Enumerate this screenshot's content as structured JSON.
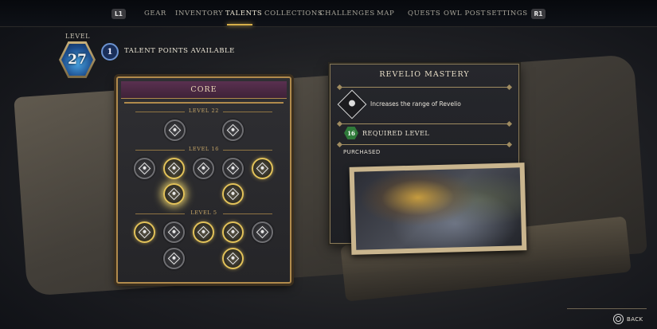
{
  "nav": {
    "left_button": "L1",
    "right_button": "R1",
    "items": [
      "GEAR",
      "INVENTORY",
      "TALENTS",
      "COLLECTIONS",
      "CHALLENGES",
      "MAP",
      "QUESTS",
      "OWL POST",
      "SETTINGS"
    ],
    "active": "TALENTS"
  },
  "player": {
    "level_label": "LEVEL",
    "level": "27",
    "talent_points": "1",
    "talent_points_label": "TALENT POINTS AVAILABLE"
  },
  "core": {
    "title": "CORE",
    "tiers": [
      {
        "label": "LEVEL 22",
        "talents": [
          {
            "icon": "diamond-rune-icon",
            "state": "locked"
          },
          {
            "icon": "diamond-rune-icon",
            "state": "locked"
          }
        ]
      },
      {
        "label": "LEVEL 16",
        "talents": [
          {
            "icon": "diamond-rune-icon",
            "state": "locked"
          },
          {
            "icon": "diamond-rune-icon",
            "state": "purchased"
          },
          {
            "icon": "diamond-rune-icon",
            "state": "locked"
          },
          {
            "icon": "diamond-rune-icon",
            "state": "locked"
          },
          {
            "icon": "diamond-rune-icon",
            "state": "purchased"
          },
          {
            "icon": "revelio-eye-icon",
            "state": "selected"
          },
          {
            "icon": "diamond-rune-icon",
            "state": "purchased"
          }
        ]
      },
      {
        "label": "LEVEL 5",
        "talents": [
          {
            "icon": "diamond-rune-icon",
            "state": "purchased"
          },
          {
            "icon": "diamond-rune-icon",
            "state": "locked"
          },
          {
            "icon": "diamond-rune-icon",
            "state": "purchased"
          },
          {
            "icon": "diamond-rune-icon",
            "state": "purchased"
          },
          {
            "icon": "diamond-rune-icon",
            "state": "locked"
          },
          {
            "icon": "diamond-rune-icon",
            "state": "locked"
          },
          {
            "icon": "diamond-rune-icon",
            "state": "purchased"
          }
        ]
      }
    ]
  },
  "detail": {
    "title": "REVELIO MASTERY",
    "description": "Increases the range of Revelio",
    "required_level": "16",
    "required_label": "REQUIRED LEVEL",
    "status": "PURCHASED"
  },
  "footer": {
    "back_label": "BACK"
  },
  "colors": {
    "gold": "#e2c25a",
    "panel_border": "#b08a4c",
    "core_header": "#5a3050",
    "level_blue": "#1d4d8c",
    "required_green": "#2f7a3a"
  }
}
